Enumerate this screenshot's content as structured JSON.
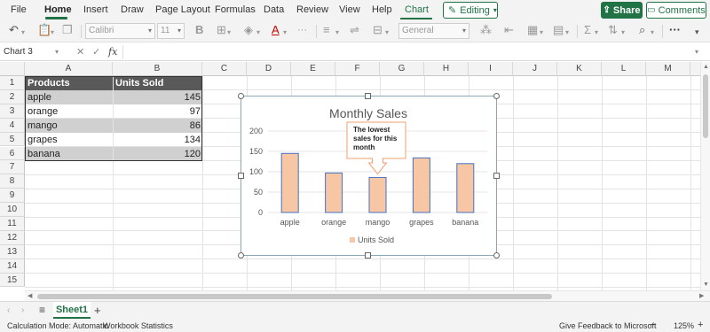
{
  "ribbon": {
    "tabs": [
      "File",
      "Home",
      "Insert",
      "Draw",
      "Page Layout",
      "Formulas",
      "Data",
      "Review",
      "View",
      "Help"
    ],
    "active_tab": "Home",
    "chart_tab": "Chart",
    "editing_label": "Editing",
    "share_label": "Share",
    "comments_label": "Comments"
  },
  "toolbar": {
    "font_name": "Calibri",
    "font_size": "11",
    "number_format": "General",
    "more_label": "···"
  },
  "formula_bar": {
    "name_box": "Chart 3",
    "fx_label": "fx",
    "formula": ""
  },
  "grid": {
    "columns": [
      "A",
      "B",
      "C",
      "D",
      "E",
      "F",
      "G",
      "H",
      "I",
      "J",
      "K",
      "L",
      "M"
    ],
    "rows": [
      "1",
      "2",
      "3",
      "4",
      "5",
      "6",
      "7",
      "8",
      "9",
      "10",
      "11",
      "12",
      "13",
      "14",
      "15"
    ],
    "table": {
      "headers": [
        "Products",
        "Units Sold"
      ],
      "rows": [
        [
          "apple",
          "145"
        ],
        [
          "orange",
          "97"
        ],
        [
          "mango",
          "86"
        ],
        [
          "grapes",
          "134"
        ],
        [
          "banana",
          "120"
        ]
      ]
    }
  },
  "chart_data": {
    "type": "bar",
    "title": "Monthly Sales",
    "categories": [
      "apple",
      "orange",
      "mango",
      "grapes",
      "banana"
    ],
    "series": [
      {
        "name": "Units Sold",
        "values": [
          145,
          97,
          86,
          134,
          120
        ]
      }
    ],
    "ylim": [
      0,
      200
    ],
    "yticks": [
      "0",
      "50",
      "100",
      "150",
      "200"
    ],
    "grid": true,
    "legend": "bottom",
    "bar_color": "#f7c6a4",
    "bar_border": "#4472c4",
    "callout": {
      "text": "The lowest sales for this month",
      "target": "mango"
    }
  },
  "sheets": {
    "tabs": [
      "Sheet1"
    ],
    "active": "Sheet1"
  },
  "status": {
    "calc_mode": "Calculation Mode: Automatic",
    "workbook_stats": "Workbook Statistics",
    "feedback": "Give Feedback to Microsoft",
    "zoom": "125%",
    "zoom_minus": "−",
    "zoom_plus": "+"
  },
  "colors": {
    "accent": "#217346"
  }
}
